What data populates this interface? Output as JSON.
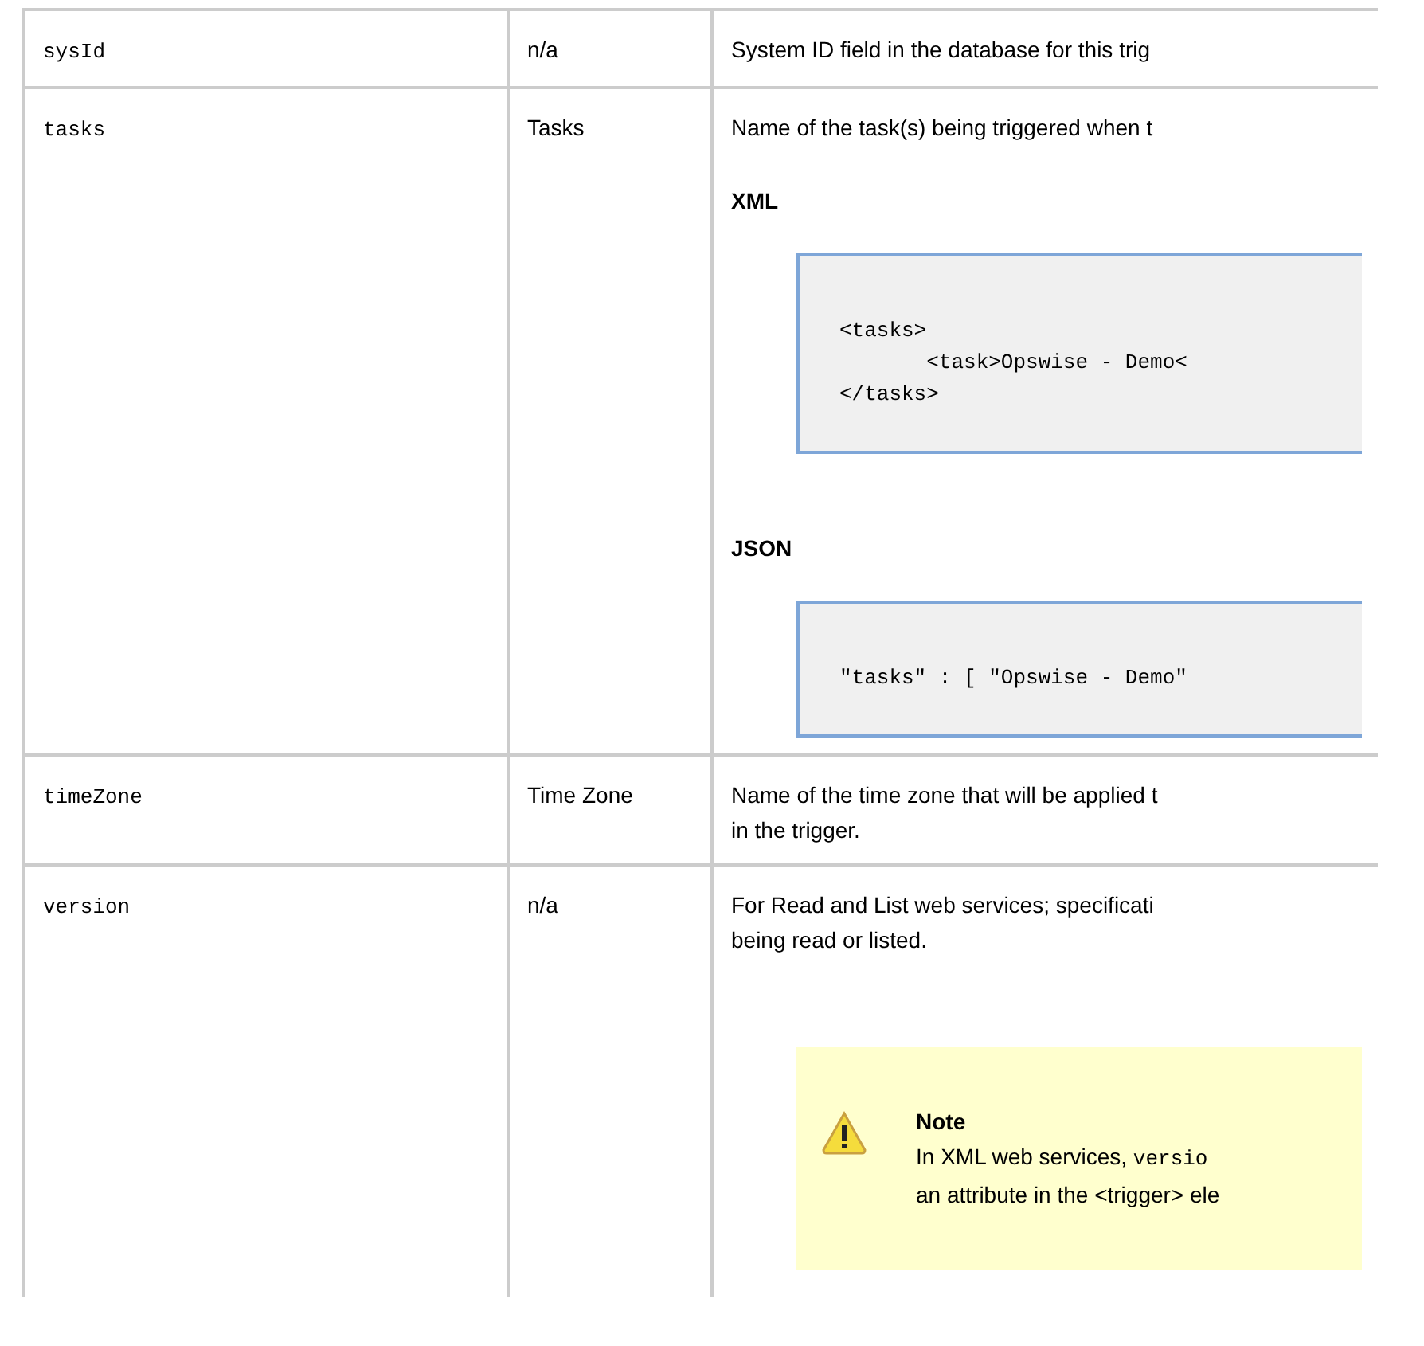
{
  "table": {
    "rows": [
      {
        "name": "sysId",
        "label": "n/a",
        "description": [
          {
            "kind": "paragraph",
            "text": "System ID field in the database for this trig"
          }
        ]
      },
      {
        "name": "tasks",
        "label": "Tasks",
        "description": [
          {
            "kind": "paragraph",
            "text": "Name of the task(s) being triggered when t"
          },
          {
            "kind": "heading",
            "text": "XML"
          },
          {
            "kind": "code",
            "text": "<tasks>\n       <task>Opswise - Demo<\n</tasks>"
          },
          {
            "kind": "heading",
            "text": "JSON"
          },
          {
            "kind": "code",
            "text": "\"tasks\" : [ \"Opswise - Demo\""
          }
        ]
      },
      {
        "name": "timeZone",
        "label": "Time Zone",
        "description": [
          {
            "kind": "paragraph",
            "text": "Name of the time zone that will be applied t\nin the trigger."
          }
        ]
      },
      {
        "name": "version",
        "label": "n/a",
        "description": [
          {
            "kind": "paragraph",
            "text": "For Read and List web services; specificati\nbeing read or listed."
          },
          {
            "kind": "note",
            "title": "Note",
            "body_start": "In XML web services, ",
            "body_code": "versio",
            "body_end": "an attribute in the <trigger> ele"
          }
        ]
      }
    ]
  }
}
